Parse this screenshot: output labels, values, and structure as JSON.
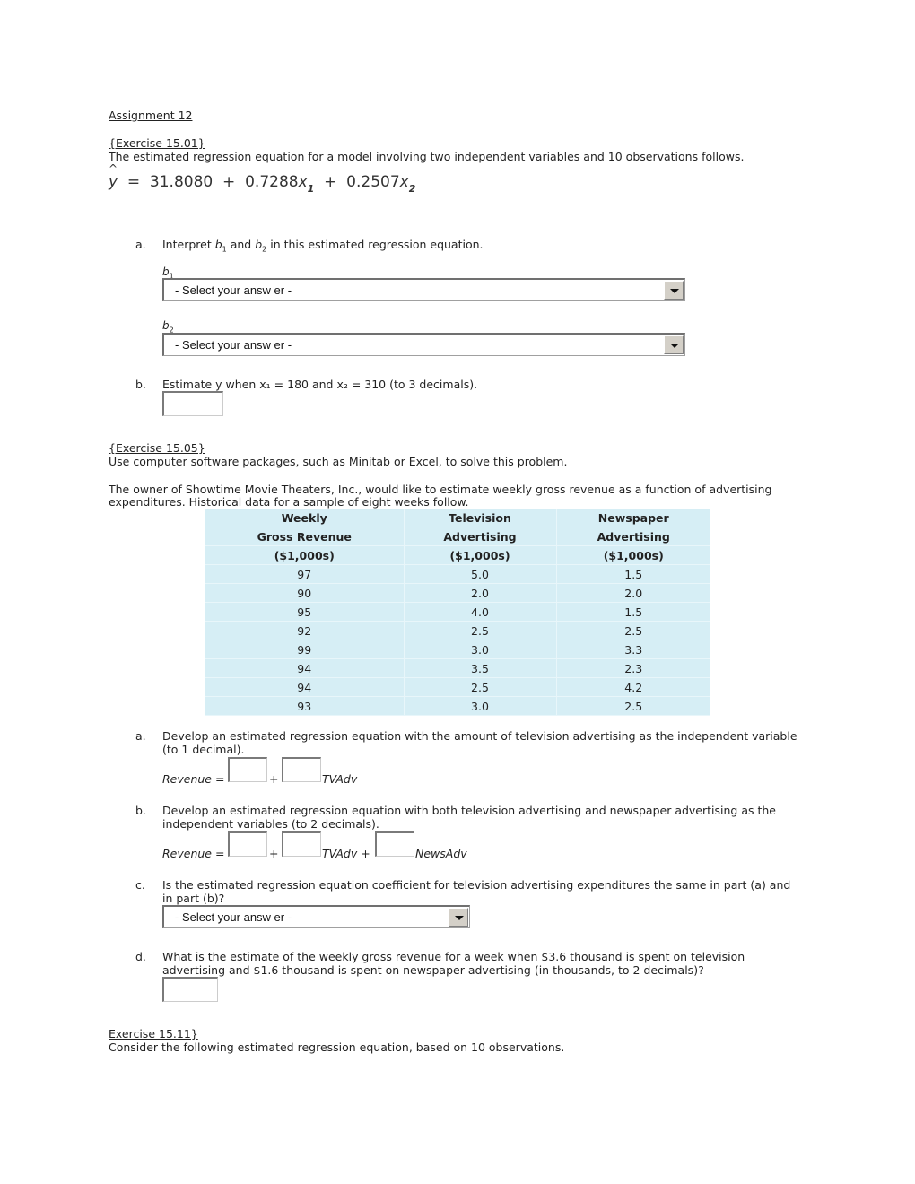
{
  "assignment_title": "Assignment 12",
  "ex1": {
    "heading": "{Exercise 15.01}",
    "intro": "The estimated regression equation for a model involving two independent variables and 10 observations follows.",
    "equation": {
      "lhs": "y",
      "hat": "^",
      "intercept": "31.8080",
      "b1": "0.7288",
      "b2": "0.2507",
      "x1": "x",
      "x1_sub": "1",
      "x2": "x",
      "x2_sub": "2"
    },
    "qa": {
      "letter": "a.",
      "text_pre": "Interpret ",
      "b1": "b",
      "b1_sub": "1",
      "mid": " and ",
      "b2": "b",
      "b2_sub": "2",
      "text_post": " in this estimated regression equation.",
      "b1_label": "b",
      "b1_label_sub": "1",
      "b2_label": "b",
      "b2_label_sub": "2",
      "select_b1": "- Select your answ er -",
      "select_b2": "- Select your answ er -"
    },
    "qb": {
      "letter": "b.",
      "text": "Estimate y when x₁ = 180 and x₂ = 310 (to 3 decimals).",
      "answer": ""
    }
  },
  "ex2": {
    "heading": "{Exercise 15.05}",
    "instruction": "Use computer software packages, such as Minitab or Excel, to solve this problem.",
    "intro_line1": "The owner of Showtime Movie Theaters, Inc., would like to estimate weekly gross revenue as a function of advertising",
    "intro_line2": "expenditures. Historical data for a sample of eight weeks follow.",
    "table": {
      "headers": [
        [
          "Weekly",
          "Television",
          "Newspaper"
        ],
        [
          "Gross Revenue",
          "Advertising",
          "Advertising"
        ],
        [
          "($1,000s)",
          "($1,000s)",
          "($1,000s)"
        ]
      ],
      "rows": [
        [
          "97",
          "5.0",
          "1.5"
        ],
        [
          "90",
          "2.0",
          "2.0"
        ],
        [
          "95",
          "4.0",
          "1.5"
        ],
        [
          "92",
          "2.5",
          "2.5"
        ],
        [
          "99",
          "3.0",
          "3.3"
        ],
        [
          "94",
          "3.5",
          "2.3"
        ],
        [
          "94",
          "2.5",
          "4.2"
        ],
        [
          "93",
          "3.0",
          "2.5"
        ]
      ]
    },
    "qa": {
      "letter": "a.",
      "line1": "Develop an estimated regression equation with the amount of television advertising as the independent variable",
      "line2": "(to 1 decimal).",
      "lhs": "Revenue =",
      "plus": "+",
      "var1": "TVAdv"
    },
    "qb": {
      "letter": "b.",
      "line1": "Develop an estimated regression equation with both television advertising and newspaper advertising as the",
      "line2": "independent variables (to 2 decimals).",
      "lhs": "Revenue =",
      "plus": "+",
      "var1": "TVAdv +",
      "var2": "NewsAdv"
    },
    "qc": {
      "letter": "c.",
      "line1": "Is the estimated regression equation coefficient for television advertising expenditures the same in part (a) and",
      "line2": "in part (b)?",
      "select": "- Select your answ er -"
    },
    "qd": {
      "letter": "d.",
      "line1": "What is the estimate of the weekly gross revenue for a week when $3.6 thousand is spent on television",
      "line2": "advertising and $1.6 thousand is spent on newspaper advertising (in thousands, to 2 decimals)?",
      "answer": ""
    }
  },
  "ex3": {
    "heading": "Exercise 15.11}",
    "intro": "Consider the following estimated regression equation, based on 10 observations."
  }
}
